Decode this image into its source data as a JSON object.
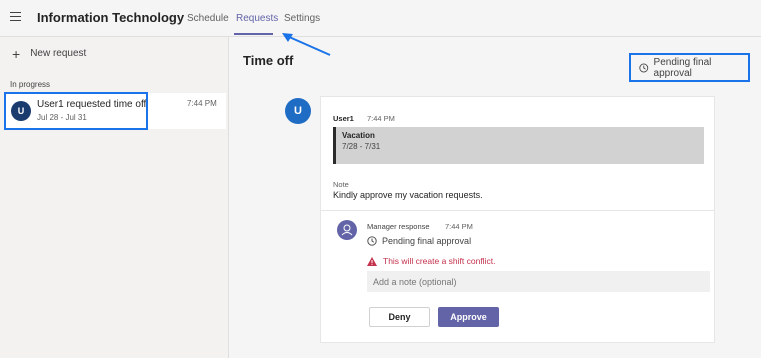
{
  "header": {
    "app_title": "Information Technology",
    "tabs": [
      {
        "label": "Schedule"
      },
      {
        "label": "Requests",
        "active": true
      },
      {
        "label": "Settings"
      }
    ]
  },
  "sidebar": {
    "new_request_label": "New request",
    "section_label": "In progress",
    "items": [
      {
        "avatar_letter": "U",
        "title": "User1 requested time off",
        "dates": "Jul 28 - Jul 31",
        "time": "7:44 PM"
      }
    ]
  },
  "main": {
    "title": "Time off",
    "status": "Pending final approval",
    "avatar_letter": "U",
    "request": {
      "user": "User1",
      "time": "7:44 PM",
      "reason": "Vacation",
      "dates": "7/28 - 7/31",
      "note_label": "Note",
      "note_text": "Kindly approve my vacation requests."
    },
    "manager": {
      "label": "Manager response",
      "time": "7:44 PM",
      "status": "Pending final approval",
      "warning": "This will create a shift conflict.",
      "note_placeholder": "Add a note (optional)",
      "deny_label": "Deny",
      "approve_label": "Approve"
    }
  },
  "colors": {
    "accent": "#6264a7",
    "highlight_annotation": "#1a73e8",
    "warning": "#c4314b"
  },
  "icons": [
    "hamburger-icon",
    "plus-icon",
    "clock-icon",
    "warning-icon",
    "person-icon"
  ]
}
